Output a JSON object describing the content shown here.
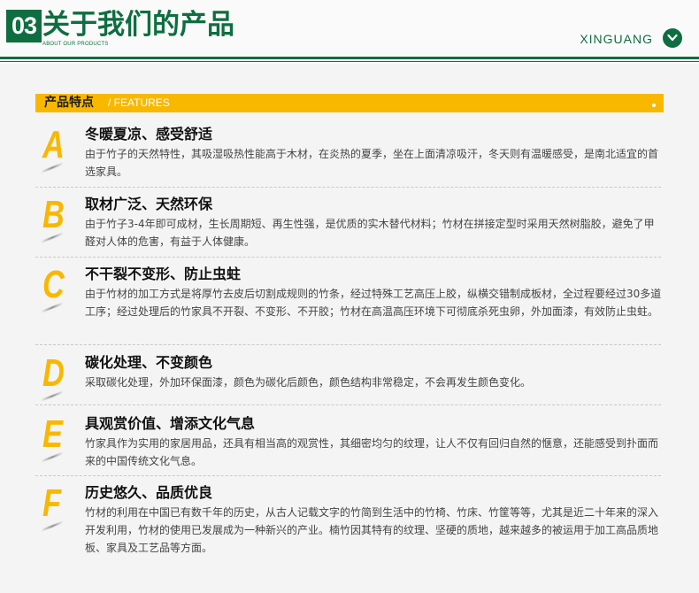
{
  "header": {
    "section_number": "03",
    "title": "关于我们的产品",
    "subtitle": "ABOUT OUR PRODUCTS",
    "brand": "XINGUANG",
    "brand_icon": "chevron-down-icon"
  },
  "features": {
    "title_cn": "产品特点",
    "title_en": "/ FEATURES"
  },
  "colors": {
    "primary_green": "#0f6e41",
    "accent_yellow": "#f8b800"
  },
  "items": [
    {
      "letter": "A",
      "title": "冬暖夏凉、感受舒适",
      "body": "由于竹子的天然特性，其吸湿吸热性能高于木材，在炎热的夏季，坐在上面清凉吸汗，冬天则有温暖感受，是南北适宜的首选家具。"
    },
    {
      "letter": "B",
      "title": "取材广泛、天然环保",
      "body": "由于竹子3-4年即可成材，生长周期短、再生性强，是优质的实木替代材料；竹材在拼接定型时采用天然树脂胶，避免了甲醛对人体的危害，有益于人体健康。"
    },
    {
      "letter": "C",
      "title": "不干裂不变形、防止虫蛀",
      "body": "由于竹材的加工方式是将厚竹去皮后切割成规则的竹条，经过特殊工艺高压上胶，纵横交错制成板材，全过程要经过30多道工序；经过处理后的竹家具不开裂、不变形、不开胶；竹材在高温高压环境下可彻底杀死虫卵，外加面漆，有效防止虫蛀。"
    },
    {
      "letter": "D",
      "title": "碳化处理、不变颜色",
      "body": "采取碳化处理，外加环保面漆，颜色为碳化后颜色，颜色结构非常稳定，不会再发生颜色变化。"
    },
    {
      "letter": "E",
      "title": "具观赏价值、增添文化气息",
      "body": "竹家具作为实用的家居用品，还具有相当高的观赏性，其细密均匀的纹理，让人不仅有回归自然的惬意，还能感受到扑面而来的中国传统文化气息。"
    },
    {
      "letter": "F",
      "title": "历史悠久、品质优良",
      "body": "竹材的利用在中国已有数千年的历史，从古人记载文字的竹简到生活中的竹椅、竹床、竹筐等等，尤其是近二十年来的深入开发利用，竹材的使用已发展成为一种新兴的产业。楠竹因其特有的纹理、坚硬的质地，越来越多的被运用于加工高品质地板、家具及工艺品等方面。"
    }
  ]
}
